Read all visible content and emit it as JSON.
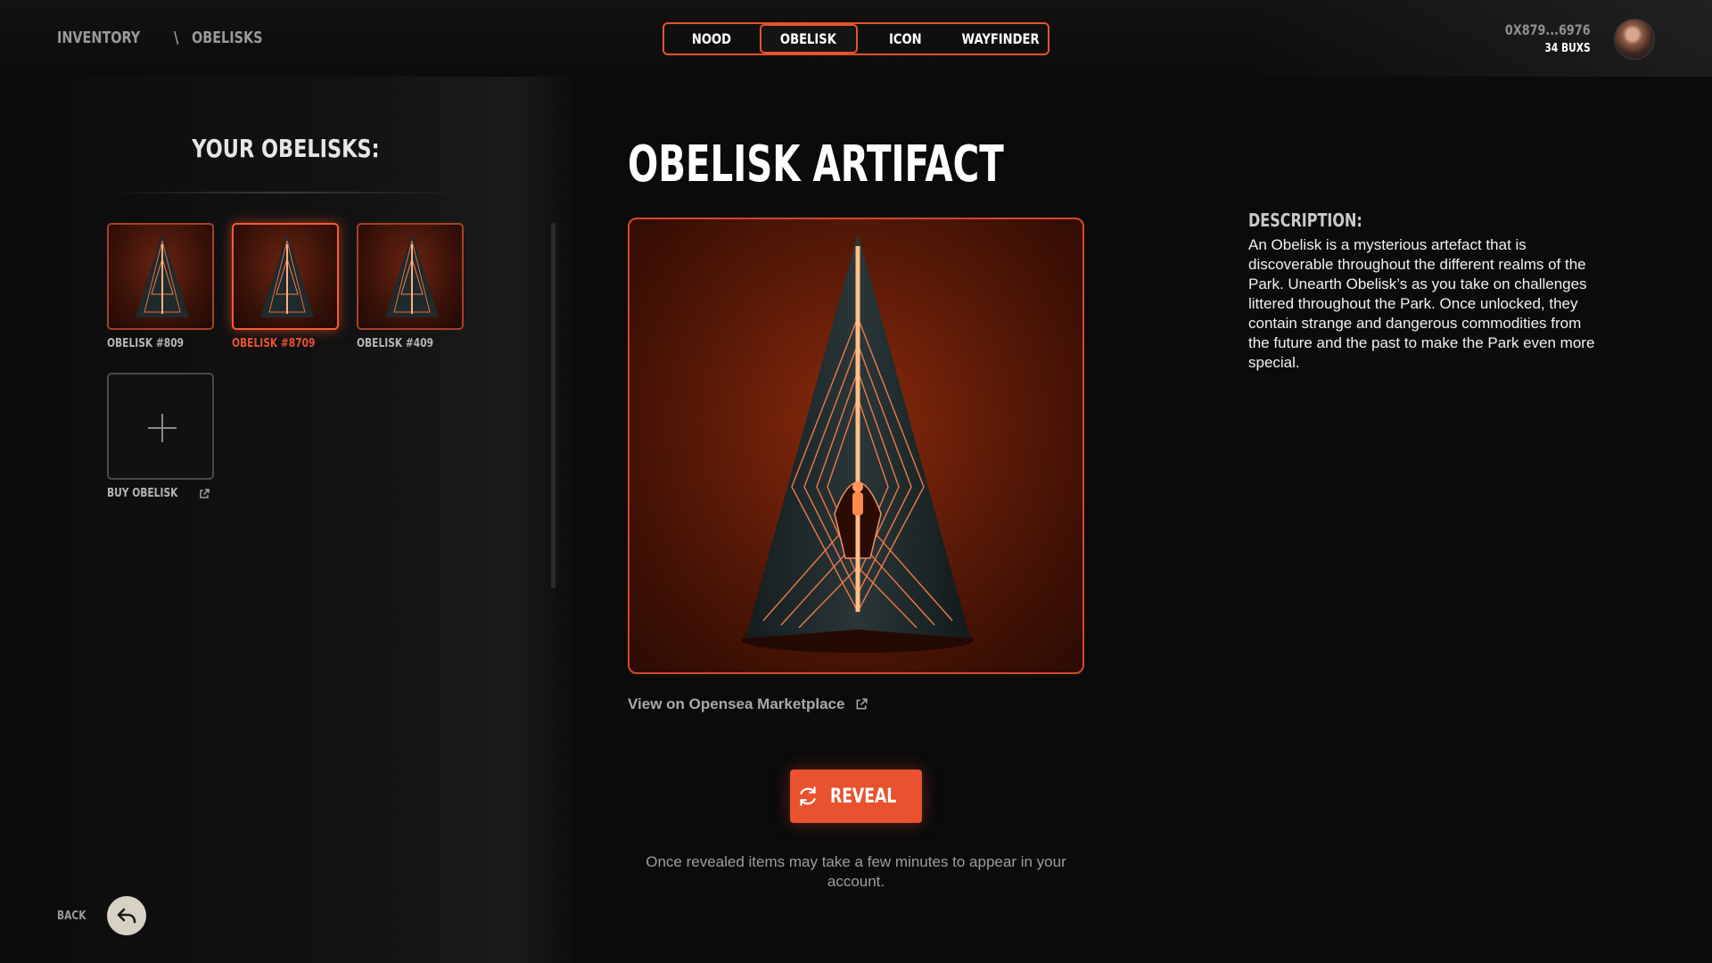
{
  "breadcrumb": {
    "root": "INVENTORY",
    "separator": "\\",
    "current": "OBELISKS"
  },
  "tabs": [
    {
      "label": "NOOD",
      "active": false
    },
    {
      "label": "OBELISK",
      "active": true
    },
    {
      "label": "ICON",
      "active": false
    },
    {
      "label": "WAYFINDER",
      "active": false
    }
  ],
  "wallet": {
    "address": "0X879...6976",
    "balance": "34 BUXS"
  },
  "sidebar": {
    "title": "YOUR OBELISKS:",
    "items": [
      {
        "label": "OBELISK #809",
        "selected": false
      },
      {
        "label": "OBELISK #8709",
        "selected": true
      },
      {
        "label": "OBELISK #409",
        "selected": false
      }
    ],
    "buy_label": "BUY OBELISK"
  },
  "back_label": "BACK",
  "main": {
    "title": "OBELISK ARTIFACT",
    "marketplace_link": "View on Opensea Marketplace",
    "reveal_label": "REVEAL",
    "reveal_note": "Once revealed items may take a few minutes to appear in your account."
  },
  "description": {
    "title": "DESCRIPTION:",
    "text": "An Obelisk is a mysterious artefact that is discoverable throughout the different realms of the Park. Unearth Obelisk’s as you take on challenges littered throughout the Park. Once unlocked, they contain strange and dangerous commodities from the future and the past to make the Park even more special."
  },
  "colors": {
    "accent": "#e8522e",
    "background": "#0b0b0b"
  },
  "icons": {
    "external_link": "external-link-icon",
    "reveal": "refresh-icon",
    "back": "reply-arrow-icon",
    "add": "plus-icon"
  }
}
